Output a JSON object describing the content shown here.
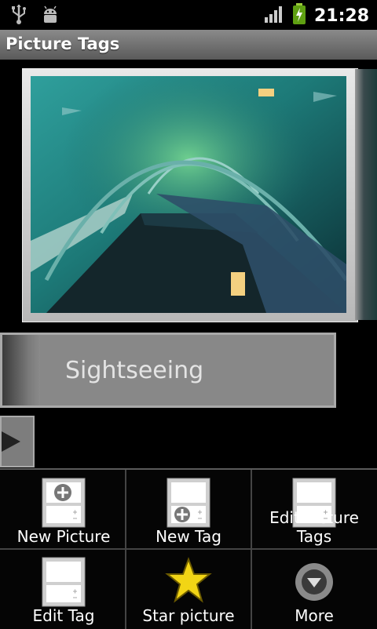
{
  "status_bar": {
    "time": "21:28",
    "icons": [
      "usb-icon",
      "android-debug-icon",
      "signal-icon",
      "battery-charging-icon"
    ]
  },
  "app": {
    "title": "Picture Tags"
  },
  "gallery": {
    "image_description": "aquarium tunnel photo"
  },
  "tag": {
    "current": "Sightseeing"
  },
  "menu": {
    "items": [
      {
        "label": "New Picture",
        "icon": "new-picture-icon"
      },
      {
        "label": "New Tag",
        "icon": "new-tag-icon"
      },
      {
        "label": "Edit Picture Tags",
        "icon": "edit-picture-tags-icon"
      },
      {
        "label": "Edit Tag",
        "icon": "edit-tag-icon"
      },
      {
        "label": "Star picture",
        "icon": "star-icon"
      },
      {
        "label": "More",
        "icon": "more-icon"
      }
    ]
  }
}
